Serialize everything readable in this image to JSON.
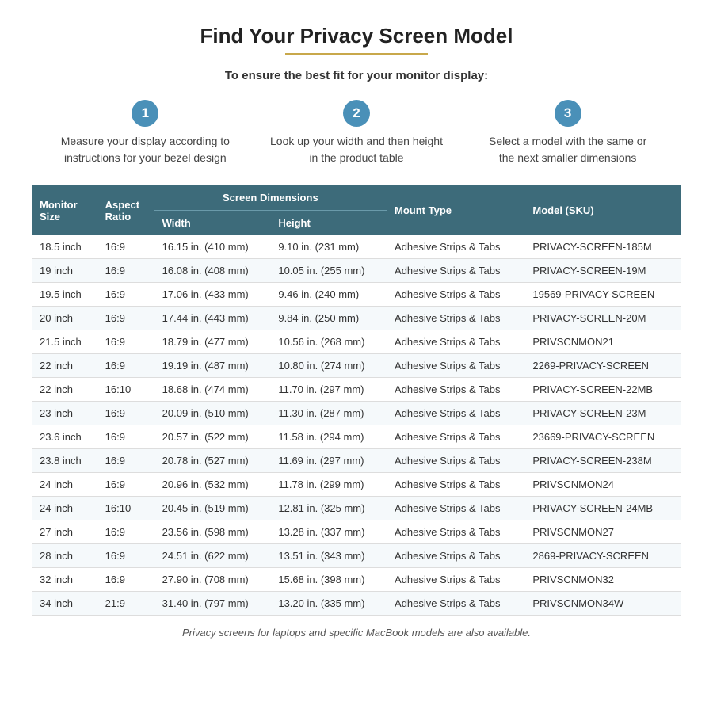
{
  "title": "Find Your Privacy Screen Model",
  "subtitle": "To ensure the best fit for your monitor display:",
  "steps": [
    {
      "number": "1",
      "text": "Measure your display according to instructions for your bezel design"
    },
    {
      "number": "2",
      "text": "Look up your width and then height in the product table"
    },
    {
      "number": "3",
      "text": "Select a model with the same or the next smaller dimensions"
    }
  ],
  "table": {
    "col_headers": {
      "monitor_size": "Monitor Size",
      "aspect_ratio": "Aspect Ratio",
      "screen_dimensions": "Screen Dimensions",
      "width": "Width",
      "height": "Height",
      "mount_type": "Mount Type",
      "model_sku": "Model (SKU)"
    },
    "rows": [
      {
        "size": "18.5 inch",
        "ratio": "16:9",
        "width": "16.15 in. (410 mm)",
        "height": "9.10 in. (231 mm)",
        "mount": "Adhesive Strips & Tabs",
        "sku": "PRIVACY-SCREEN-185M"
      },
      {
        "size": "19 inch",
        "ratio": "16:9",
        "width": "16.08 in. (408 mm)",
        "height": "10.05 in. (255 mm)",
        "mount": "Adhesive Strips & Tabs",
        "sku": "PRIVACY-SCREEN-19M"
      },
      {
        "size": "19.5 inch",
        "ratio": "16:9",
        "width": "17.06 in. (433 mm)",
        "height": "9.46 in. (240 mm)",
        "mount": "Adhesive Strips & Tabs",
        "sku": "19569-PRIVACY-SCREEN"
      },
      {
        "size": "20 inch",
        "ratio": "16:9",
        "width": "17.44 in. (443 mm)",
        "height": "9.84 in. (250 mm)",
        "mount": "Adhesive Strips & Tabs",
        "sku": "PRIVACY-SCREEN-20M"
      },
      {
        "size": "21.5 inch",
        "ratio": "16:9",
        "width": "18.79 in. (477 mm)",
        "height": "10.56 in. (268 mm)",
        "mount": "Adhesive Strips & Tabs",
        "sku": "PRIVSCNMON21"
      },
      {
        "size": "22 inch",
        "ratio": "16:9",
        "width": "19.19 in. (487 mm)",
        "height": "10.80 in. (274 mm)",
        "mount": "Adhesive Strips & Tabs",
        "sku": "2269-PRIVACY-SCREEN"
      },
      {
        "size": "22 inch",
        "ratio": "16:10",
        "width": "18.68 in. (474 mm)",
        "height": "11.70 in. (297 mm)",
        "mount": "Adhesive Strips & Tabs",
        "sku": "PRIVACY-SCREEN-22MB"
      },
      {
        "size": "23 inch",
        "ratio": "16:9",
        "width": "20.09 in. (510 mm)",
        "height": "11.30 in. (287 mm)",
        "mount": "Adhesive Strips & Tabs",
        "sku": "PRIVACY-SCREEN-23M"
      },
      {
        "size": "23.6 inch",
        "ratio": "16:9",
        "width": "20.57 in. (522 mm)",
        "height": "11.58 in. (294 mm)",
        "mount": "Adhesive Strips & Tabs",
        "sku": "23669-PRIVACY-SCREEN"
      },
      {
        "size": "23.8 inch",
        "ratio": "16:9",
        "width": "20.78 in. (527 mm)",
        "height": "11.69 in. (297 mm)",
        "mount": "Adhesive Strips & Tabs",
        "sku": "PRIVACY-SCREEN-238M"
      },
      {
        "size": "24 inch",
        "ratio": "16:9",
        "width": "20.96 in. (532 mm)",
        "height": "11.78 in. (299 mm)",
        "mount": "Adhesive Strips & Tabs",
        "sku": "PRIVSCNMON24"
      },
      {
        "size": "24 inch",
        "ratio": "16:10",
        "width": "20.45 in. (519 mm)",
        "height": "12.81 in. (325 mm)",
        "mount": "Adhesive Strips & Tabs",
        "sku": "PRIVACY-SCREEN-24MB"
      },
      {
        "size": "27 inch",
        "ratio": "16:9",
        "width": "23.56 in. (598 mm)",
        "height": "13.28 in. (337 mm)",
        "mount": "Adhesive Strips & Tabs",
        "sku": "PRIVSCNMON27"
      },
      {
        "size": "28 inch",
        "ratio": "16:9",
        "width": "24.51 in. (622 mm)",
        "height": "13.51 in. (343 mm)",
        "mount": "Adhesive Strips & Tabs",
        "sku": "2869-PRIVACY-SCREEN"
      },
      {
        "size": "32 inch",
        "ratio": "16:9",
        "width": "27.90 in. (708 mm)",
        "height": "15.68 in. (398 mm)",
        "mount": "Adhesive Strips & Tabs",
        "sku": "PRIVSCNMON32"
      },
      {
        "size": "34 inch",
        "ratio": "21:9",
        "width": "31.40 in. (797 mm)",
        "height": "13.20 in. (335 mm)",
        "mount": "Adhesive Strips & Tabs",
        "sku": "PRIVSCNMON34W"
      }
    ]
  },
  "footer_note": "Privacy screens for laptops and specific MacBook models are also available."
}
